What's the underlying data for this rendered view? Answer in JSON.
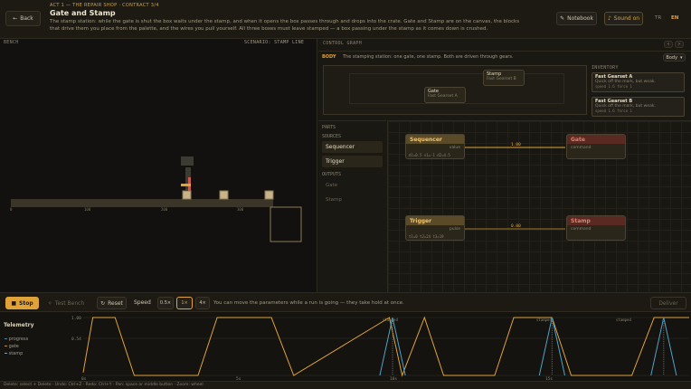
{
  "topbar": {
    "back_label": "Back",
    "breadcrumb": "ACT 1 — THE REPAIR SHOP · CONTRACT 3/4",
    "title": "Gate and Stamp",
    "description_line1": "The stamp station: while the gate is shut the box waits under the stamp, and when it opens the box passes through and drops into the crate. Gate and Stamp are on the canvas, the blocks",
    "description_line2": "that drive them you place from the palette, and the wires you pull yourself. All three boxes must leave stamped — a box passing under the stamp as it comes down is crushed.",
    "notebook_label": "Notebook",
    "sound_label": "Sound on",
    "lang_tr": "TR",
    "lang_en": "EN"
  },
  "bench": {
    "label": "BENCH",
    "scenario": "SCENARIO: STAMP LINE",
    "ticks": [
      "0",
      "100",
      "200",
      "300"
    ]
  },
  "control_graph": {
    "label": "CONTROL GRAPH",
    "body_tag": "BODY",
    "body_text": "The stamping station: one gate, one stamp. Both are driven through gears.",
    "body_dropdown": "Body",
    "parts": [
      {
        "name": "Stamp",
        "sub": "Fast Gearset B"
      },
      {
        "name": "Gate",
        "sub": "Fast Gearset A"
      }
    ],
    "inventory_label": "INVENTORY",
    "inventory": [
      {
        "name": "Fast Gearset A",
        "desc": "Quick off the mark, but weak.",
        "stats": "speed  1.6   force 1"
      },
      {
        "name": "Fast Gearset B",
        "desc": "Quick off the mark, but weak.",
        "stats": "speed  1.6   force 1"
      }
    ]
  },
  "palette": {
    "parts_label": "PARTS",
    "sources_label": "SOURCES",
    "sources": [
      "Sequencer",
      "Trigger"
    ],
    "outputs_label": "OUTPUTS",
    "outputs": [
      "Gate",
      "Stamp"
    ]
  },
  "graph": {
    "sequencer": {
      "title": "Sequencer",
      "port": "value",
      "params": "d1=0.5  v1=-1  d2=4.5"
    },
    "gate": {
      "title": "Gate",
      "port": "command"
    },
    "trigger": {
      "title": "Trigger",
      "port": "pulse",
      "params": "t1=0  t2=24  t3=19"
    },
    "stamp": {
      "title": "Stamp",
      "port": "command"
    },
    "wire1_value": "1.00",
    "wire2_value": "0.00"
  },
  "controls": {
    "stop_label": "Stop",
    "test_label": "Test Bench",
    "reset_label": "Reset",
    "speed_label": "Speed",
    "speeds": [
      "0.5×",
      "1×",
      "4×"
    ],
    "hint": "You can move the parameters while a run is going — they take hold at once.",
    "deliver_label": "Deliver"
  },
  "telemetry": {
    "label": "Telemetry",
    "legend": [
      {
        "name": "progress",
        "color": "#4fa3c7"
      },
      {
        "name": "gate",
        "color": "#e0a33a"
      },
      {
        "name": "stamp",
        "color": "#8ab8d8"
      }
    ],
    "y_ticks": [
      "1.00",
      "0.54"
    ],
    "x_ticks": [
      "0s",
      "5s",
      "10s",
      "15s"
    ],
    "markers": [
      "stamped",
      "stamped",
      "stamped"
    ]
  },
  "chart_data": {
    "type": "line",
    "x": [
      0,
      0.3,
      1.0,
      1.6,
      3.6,
      4.2,
      5.9,
      6.6,
      9.6,
      10.0,
      10.7,
      11.3,
      12.9,
      13.5,
      14.7,
      15.3,
      17.2,
      17.9,
      19.0
    ],
    "series": [
      {
        "name": "gate",
        "values": [
          0.05,
          1,
          1,
          0,
          0,
          1,
          1,
          0,
          1,
          0,
          1,
          0,
          0,
          1,
          1,
          0,
          0,
          1,
          1
        ]
      }
    ],
    "spikes": [
      {
        "name": "progress",
        "x": [
          9.3,
          10.1,
          14.3,
          15.1,
          17.8,
          18.6
        ]
      }
    ],
    "ylim": [
      0,
      1
    ],
    "xlim": [
      0,
      19
    ]
  },
  "status": {
    "text": "Delete: select + Delete · Undo: Ctrl+Z · Redo: Ctrl+Y · Pan: space or middle button · Zoom: wheel"
  },
  "colors": {
    "accent": "#e0a33a",
    "red": "#c85a4a",
    "blue": "#4fa3c7"
  }
}
